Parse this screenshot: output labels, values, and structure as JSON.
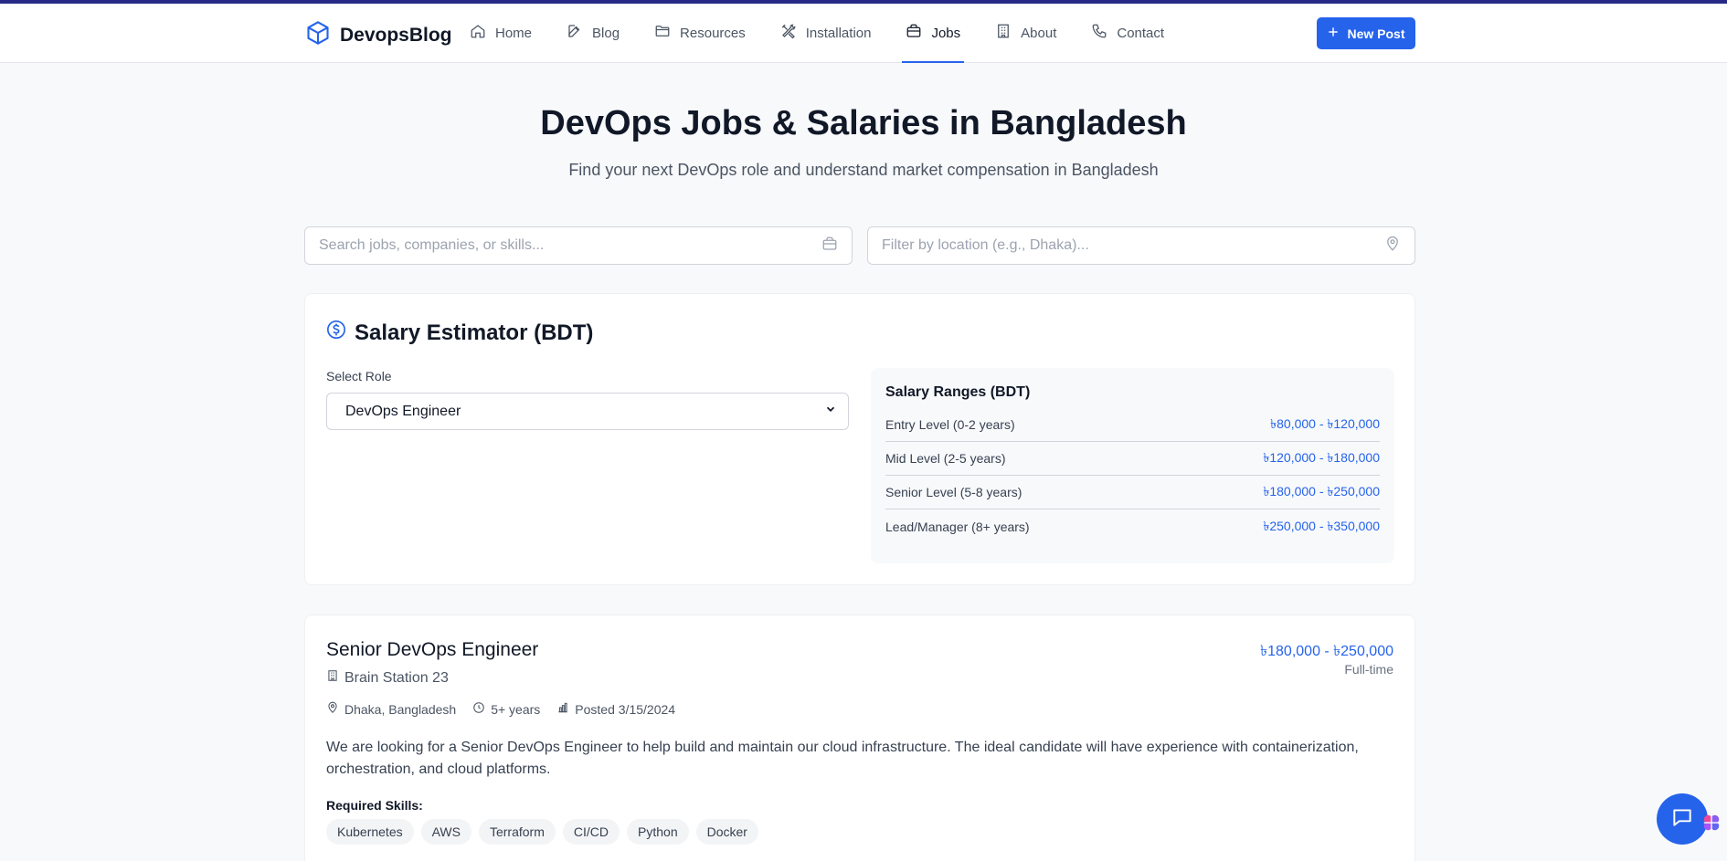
{
  "brand": {
    "name": "DevopsBlog"
  },
  "nav": {
    "items": [
      {
        "label": "Home",
        "icon": "home-icon"
      },
      {
        "label": "Blog",
        "icon": "edit-icon"
      },
      {
        "label": "Resources",
        "icon": "folder-icon"
      },
      {
        "label": "Installation",
        "icon": "tools-icon"
      },
      {
        "label": "Jobs",
        "icon": "briefcase-icon",
        "active": true
      },
      {
        "label": "About",
        "icon": "building-icon"
      },
      {
        "label": "Contact",
        "icon": "phone-icon"
      }
    ],
    "new_post_label": "New Post"
  },
  "hero": {
    "title": "DevOps Jobs & Salaries in Bangladesh",
    "subtitle": "Find your next DevOps role and understand market compensation in Bangladesh"
  },
  "search": {
    "jobs_placeholder": "Search jobs, companies, or skills...",
    "location_placeholder": "Filter by location (e.g., Dhaka)..."
  },
  "estimator": {
    "title": "Salary Estimator (BDT)",
    "select_label": "Select Role",
    "selected_role": "DevOps Engineer",
    "ranges_title": "Salary Ranges (BDT)",
    "ranges": [
      {
        "label": "Entry Level (0-2 years)",
        "value": "৳80,000 - ৳120,000"
      },
      {
        "label": "Mid Level (2-5 years)",
        "value": "৳120,000 - ৳180,000"
      },
      {
        "label": "Senior Level (5-8 years)",
        "value": "৳180,000 - ৳250,000"
      },
      {
        "label": "Lead/Manager (8+ years)",
        "value": "৳250,000 - ৳350,000"
      }
    ]
  },
  "job": {
    "title": "Senior DevOps Engineer",
    "company": "Brain Station 23",
    "salary": "৳180,000 - ৳250,000",
    "type": "Full-time",
    "location": "Dhaka, Bangladesh",
    "experience": "5+ years",
    "posted": "Posted 3/15/2024",
    "description": "We are looking for a Senior DevOps Engineer to help build and maintain our cloud infrastructure. The ideal candidate will have experience with containerization, orchestration, and cloud platforms.",
    "skills_label": "Required Skills:",
    "skills": [
      "Kubernetes",
      "AWS",
      "Terraform",
      "CI/CD",
      "Python",
      "Docker"
    ]
  },
  "colors": {
    "accent": "#2563eb",
    "top_stripe": "#262a86",
    "background": "#f8f9fb"
  }
}
